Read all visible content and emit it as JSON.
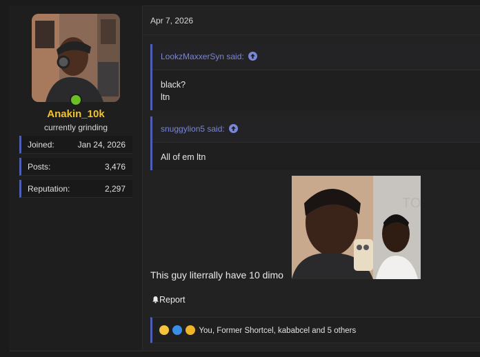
{
  "post": {
    "date": "Apr 7, 2026",
    "author": {
      "username": "Anakin_10k",
      "user_title": "currently grinding",
      "stats": [
        {
          "key": "Joined:",
          "value": "Jan 24, 2026"
        },
        {
          "key": "Posts:",
          "value": "3,476"
        },
        {
          "key": "Reputation:",
          "value": "2,297"
        }
      ],
      "online_color": "#6bbf24"
    },
    "quotes": [
      {
        "author": "LookzMaxxerSyn said:",
        "lines": [
          "black?",
          "ltn"
        ]
      },
      {
        "author": "snuggylion5 said:",
        "lines": [
          "All of em ltn"
        ]
      }
    ],
    "body_text": "This guy literrally have 10 dimo",
    "report_label": "Report",
    "reactions_text": "You, Former Shortcel, kababcel and 5 others"
  },
  "colors": {
    "accent": "#4f5fb5",
    "quote_author": "#7a86d6",
    "username": "#f2c230"
  }
}
